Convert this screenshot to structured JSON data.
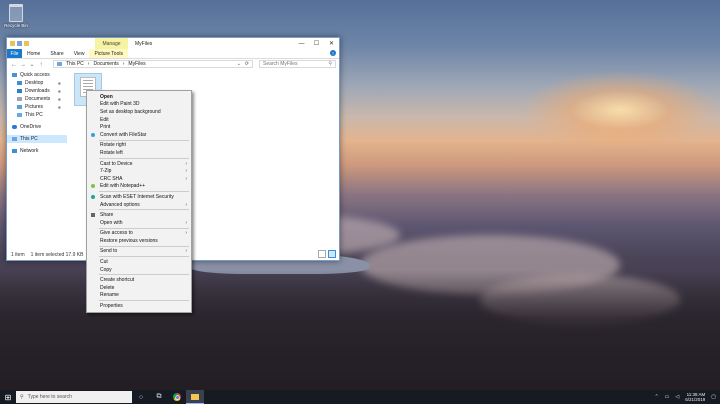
{
  "desktop": {
    "recycle_bin_label": "Recycle Bin"
  },
  "window": {
    "manage_label": "Manage",
    "title": "MyFiles",
    "controls": {
      "min": "—",
      "max": "☐",
      "close": "✕"
    },
    "ribbon": {
      "file": "File",
      "tabs": [
        "Home",
        "Share",
        "View",
        "Picture Tools"
      ]
    },
    "address": {
      "back": "←",
      "forward": "→",
      "recent": "⌄",
      "up": "↑",
      "path": [
        "This PC",
        "Documents",
        "MyFiles"
      ],
      "dropdown": "⌄",
      "refresh": "⟳"
    },
    "search": {
      "placeholder": "Search MyFiles"
    },
    "nav": {
      "quick_access": "Quick access",
      "desktop": "Desktop",
      "downloads": "Downloads",
      "documents": "Documents",
      "pictures": "Pictures",
      "this_pc": "This PC",
      "onedrive": "OneDrive",
      "this_pc2": "This PC",
      "network": "Network"
    },
    "status": {
      "count": "1 item",
      "selected": "1 item selected 17.9 KB"
    }
  },
  "context_menu": {
    "open": "Open",
    "paint3d": "Edit with Paint 3D",
    "desktop_bg": "Set as desktop background",
    "edit": "Edit",
    "print": "Print",
    "filestar": "Convert with FileStar",
    "rotate_right": "Rotate right",
    "rotate_left": "Rotate left",
    "cast": "Cast to Device",
    "zip": "7-Zip",
    "crc": "CRC SHA",
    "notepad": "Edit with Notepad++",
    "eset": "Scan with ESET Internet Security",
    "advanced": "Advanced options",
    "share": "Share",
    "open_with": "Open with",
    "give_access": "Give access to",
    "restore": "Restore previous versions",
    "send_to": "Send to",
    "cut": "Cut",
    "copy": "Copy",
    "create_shortcut": "Create shortcut",
    "delete": "Delete",
    "rename": "Rename",
    "properties": "Properties"
  },
  "taskbar": {
    "search_placeholder": "Type here to search",
    "time": "11:38 AM",
    "date": "6/21/2019"
  }
}
